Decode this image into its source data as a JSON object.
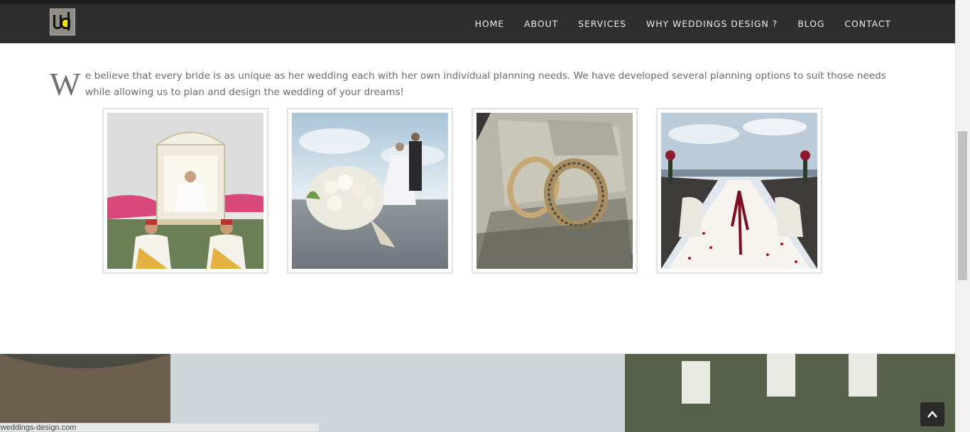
{
  "header": {
    "logo_alt": "wd logo",
    "nav": [
      {
        "label": "HOME"
      },
      {
        "label": "ABOUT"
      },
      {
        "label": "SERVICES"
      },
      {
        "label": "WHY WEDDINGS DESIGN ?"
      },
      {
        "label": "BLOG"
      },
      {
        "label": "CONTACT"
      }
    ]
  },
  "intro": {
    "dropcap": "W",
    "text": "e believe that every bride is as unique as her wedding each with her own individual planning needs. We have developed several planning options to suit those needs while allowing us to plan and design the wedding of your dreams!"
  },
  "gallery": [
    {
      "icon": "bride-procession-photo"
    },
    {
      "icon": "bouquet-couple-photo"
    },
    {
      "icon": "rings-money-photo"
    },
    {
      "icon": "aisle-decor-photo"
    }
  ],
  "status_bar": {
    "url": "weddings-design.com"
  },
  "colors": {
    "header_bg": "#2e2e2e",
    "nav_text": "#ececec",
    "body_text": "#6a6a6a",
    "logo_accent": "#f2e01b"
  }
}
